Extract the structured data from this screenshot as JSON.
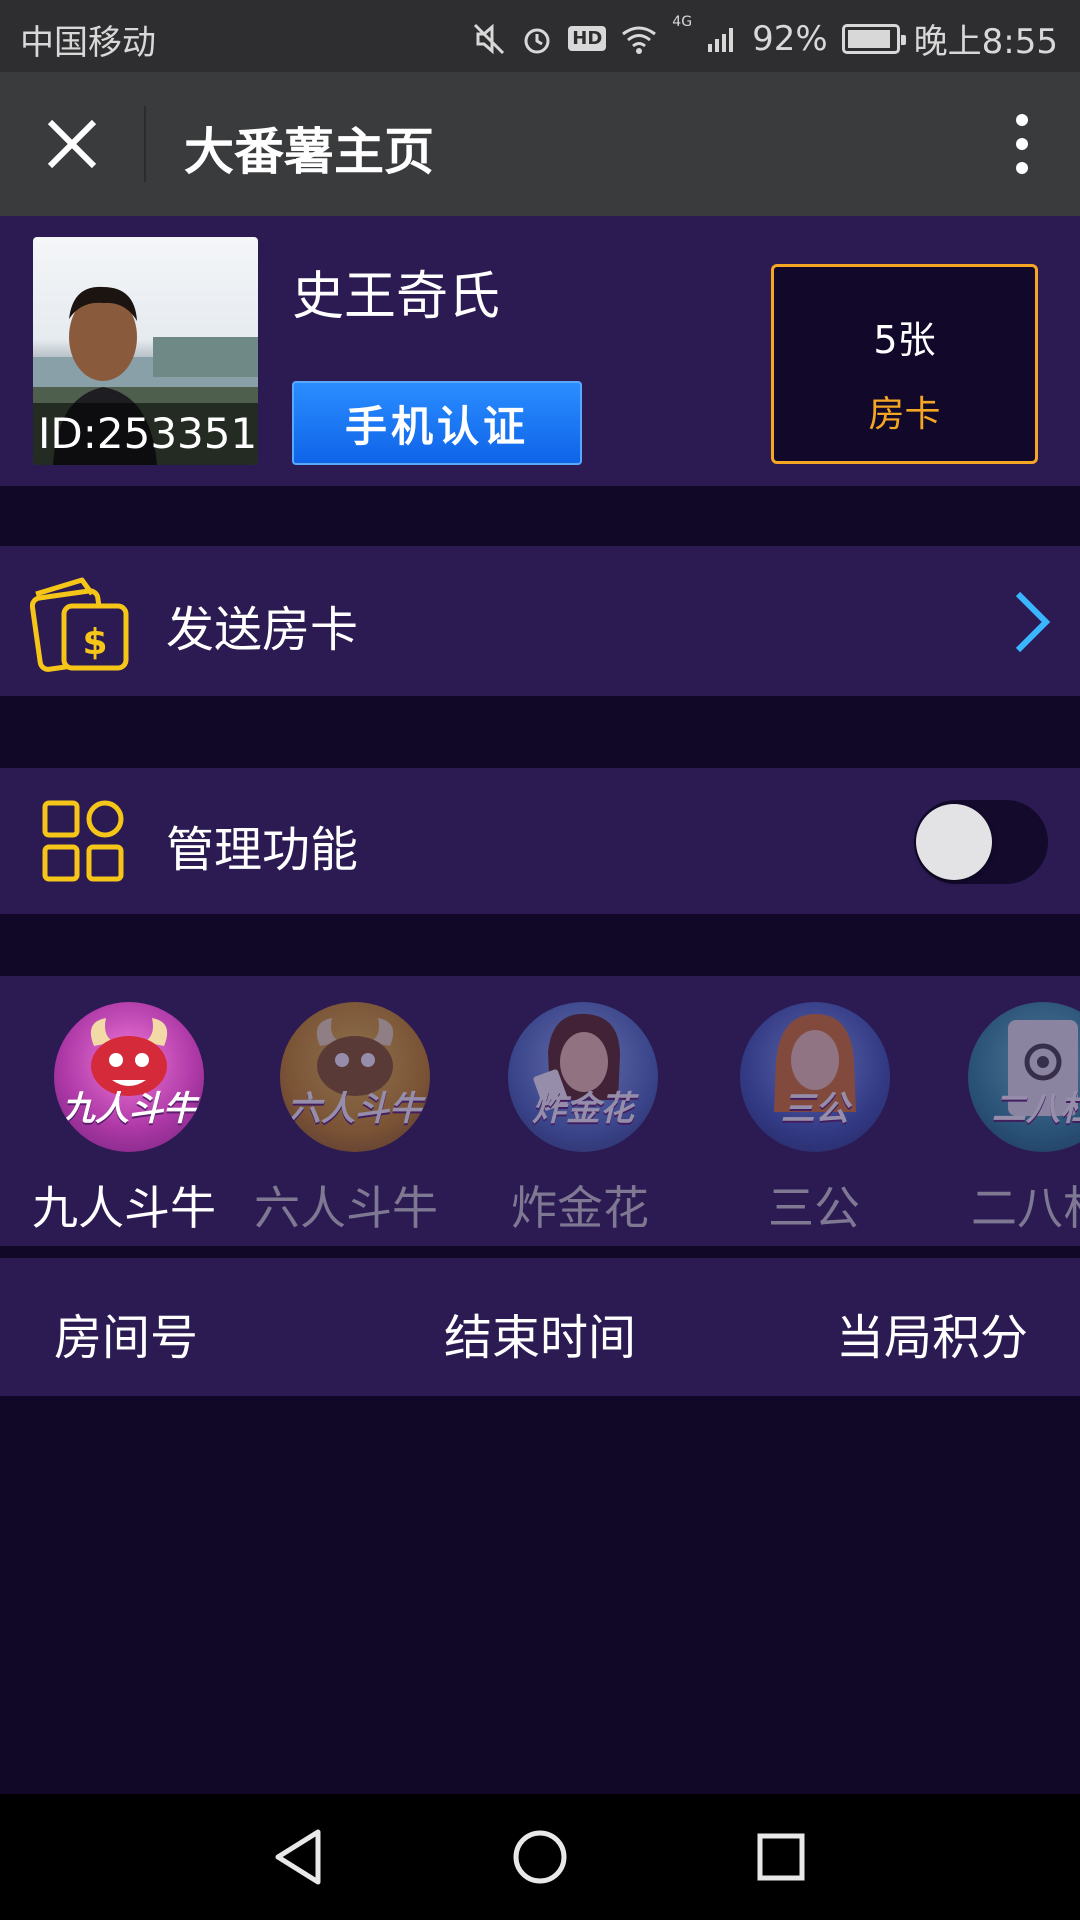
{
  "status_bar": {
    "carrier": "中国移动",
    "hd": "HD",
    "network": "4G",
    "battery": "92%",
    "battery_level": 0.92,
    "time": "晚上8:55"
  },
  "title_bar": {
    "title": "大番薯主页"
  },
  "profile": {
    "username": "史王奇氏",
    "id_label": "ID:253351",
    "verify_label": "手机认证",
    "card_count": "5张",
    "card_label": "房卡"
  },
  "send_card": {
    "label": "发送房卡"
  },
  "manage": {
    "label": "管理功能",
    "toggle_on": false
  },
  "games": [
    {
      "name": "九人斗牛",
      "icon_text": "九人斗牛",
      "active": true
    },
    {
      "name": "六人斗牛",
      "icon_text": "六人斗牛",
      "active": false
    },
    {
      "name": "炸金花",
      "icon_text": "炸金花",
      "active": false
    },
    {
      "name": "三公",
      "icon_text": "三公",
      "active": false
    },
    {
      "name": "二八杠",
      "icon_text": "二八杠",
      "active": false
    }
  ],
  "table": {
    "columns": [
      "房间号",
      "结束时间",
      "当局积分"
    ]
  },
  "colors": {
    "background": "#100826",
    "panel": "#2b1b52",
    "accent_orange": "#f5a623",
    "accent_blue": "#1a7dff",
    "chevron": "#3ab6ff"
  }
}
